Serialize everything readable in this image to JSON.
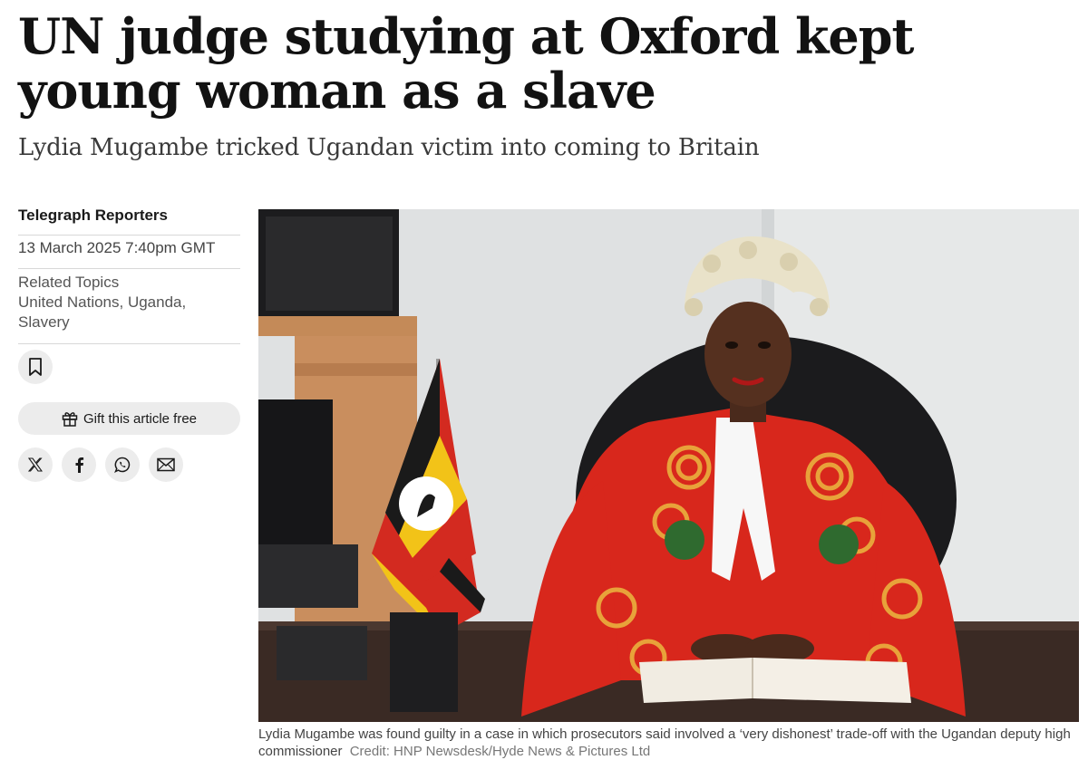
{
  "article": {
    "headline": "UN judge studying at Oxford kept young woman as a slave",
    "standfirst": "Lydia Mugambe tricked Ugandan victim into coming to Britain"
  },
  "meta": {
    "author": "Telegraph Reporters",
    "date": "13 March 2025 7:40pm GMT",
    "related_topics_label": "Related Topics",
    "related_topics": "United Nations, Uganda, Slavery"
  },
  "actions": {
    "bookmark_icon": "bookmark-icon",
    "gift_label": "Gift this article free",
    "gift_icon": "gift-icon",
    "share": [
      "x-icon",
      "facebook-icon",
      "whatsapp-icon",
      "email-icon"
    ]
  },
  "figure": {
    "caption": "Lydia Mugambe was found guilty in a case in which prosecutors said involved a ‘very dishonest’ trade-off with the Ugandan deputy high commissioner",
    "credit": "Credit: HNP Newsdesk/Hyde News & Pictures Ltd"
  },
  "colors": {
    "robe_red": "#d8271c",
    "robe_gold": "#e8a23a",
    "wall": "#dcdfe0",
    "wood": "#c98e5e",
    "flag_yellow": "#f2c318",
    "flag_red": "#d32a20"
  }
}
